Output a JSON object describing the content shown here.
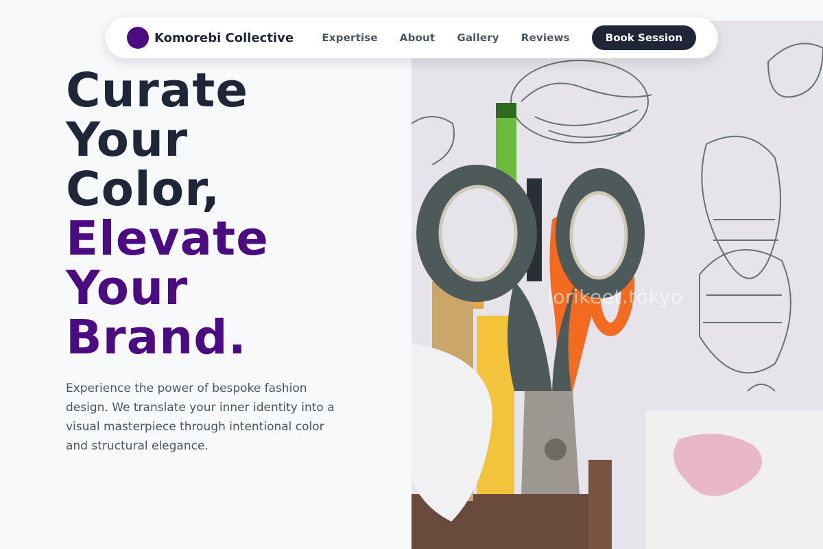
{
  "brand": {
    "name": "Komorebi Collective",
    "accent_color": "#4a0c80",
    "dark_color": "#1e2638"
  },
  "nav": {
    "links": [
      "Expertise",
      "About",
      "Gallery",
      "Reviews"
    ],
    "cta_label": "Book Session"
  },
  "hero": {
    "headline_dark": [
      "Curate",
      "Your",
      "Color,"
    ],
    "headline_accent": [
      "Elevate",
      "Your",
      "Brand."
    ],
    "subcopy": "Experience the power of bespoke fashion design. We translate your inner identity into a visual masterpiece through intentional color and structural elegance.",
    "image_watermark": "lorikeet.tokyo"
  }
}
